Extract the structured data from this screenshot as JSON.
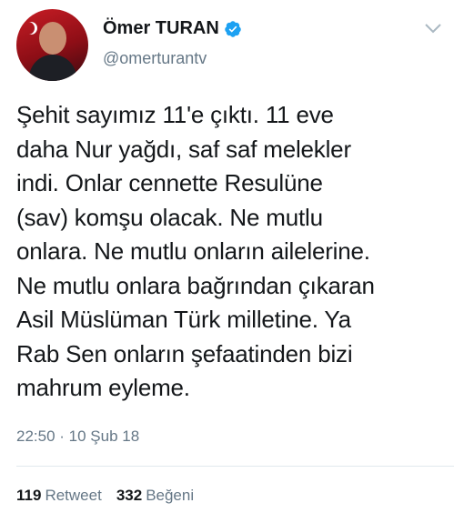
{
  "user": {
    "name": "Ömer TURAN",
    "handle": "@omerturantv",
    "verified_color": "#1da1f2"
  },
  "tweet": {
    "lines": [
      "Şehit sayımız 11'e çıktı. 11 eve",
      "daha Nur yağdı, saf saf melekler",
      "indi. Onlar cennette Resulüne",
      "(sav) komşu olacak. Ne mutlu",
      "onlara. Ne mutlu onların ailelerine.",
      "Ne mutlu onlara bağrından çıkaran",
      "Asil Müslüman Türk milletine. Ya",
      "Rab Sen onların şefaatinden bizi",
      "mahrum eyleme."
    ],
    "timestamp": "22:50 · 10 Şub 18"
  },
  "stats": {
    "retweets_count": "119",
    "retweets_label": "Retweet",
    "likes_count": "332",
    "likes_label": "Beğeni"
  }
}
